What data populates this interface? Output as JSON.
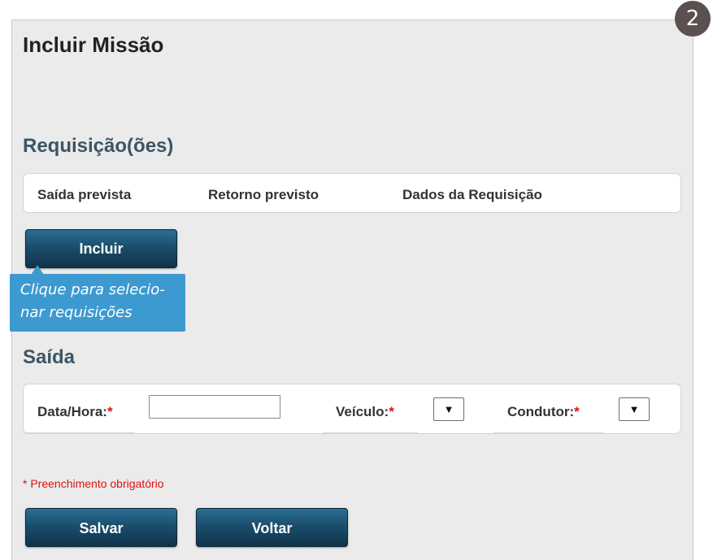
{
  "step_badge": "2",
  "page_title": "Incluir Missão",
  "requisicoes": {
    "title": "Requisição(ões)",
    "columns": [
      "Saída prevista",
      "Retorno previsto",
      "Dados da Requisição"
    ],
    "include_button": "Incluir"
  },
  "tooltip": {
    "lines": [
      "Clique para selecio-",
      "nar requisições"
    ],
    "color": "#3d9ad0"
  },
  "saida": {
    "title": "Saída",
    "fields": {
      "data_hora": {
        "label": "Data/Hora:",
        "value": ""
      },
      "veiculo": {
        "label": "Veículo:",
        "selected": ""
      },
      "condutor": {
        "label": "Condutor:",
        "selected": ""
      }
    },
    "required_mark": "*",
    "dropdown_arrow": "▼"
  },
  "required_note": "* Preenchimento obrigatório",
  "actions": {
    "save": "Salvar",
    "back": "Voltar"
  },
  "colors": {
    "button": "#1a4e6d",
    "section_title": "#3d5566",
    "required": "#e01010",
    "badge": "#5a5050"
  }
}
